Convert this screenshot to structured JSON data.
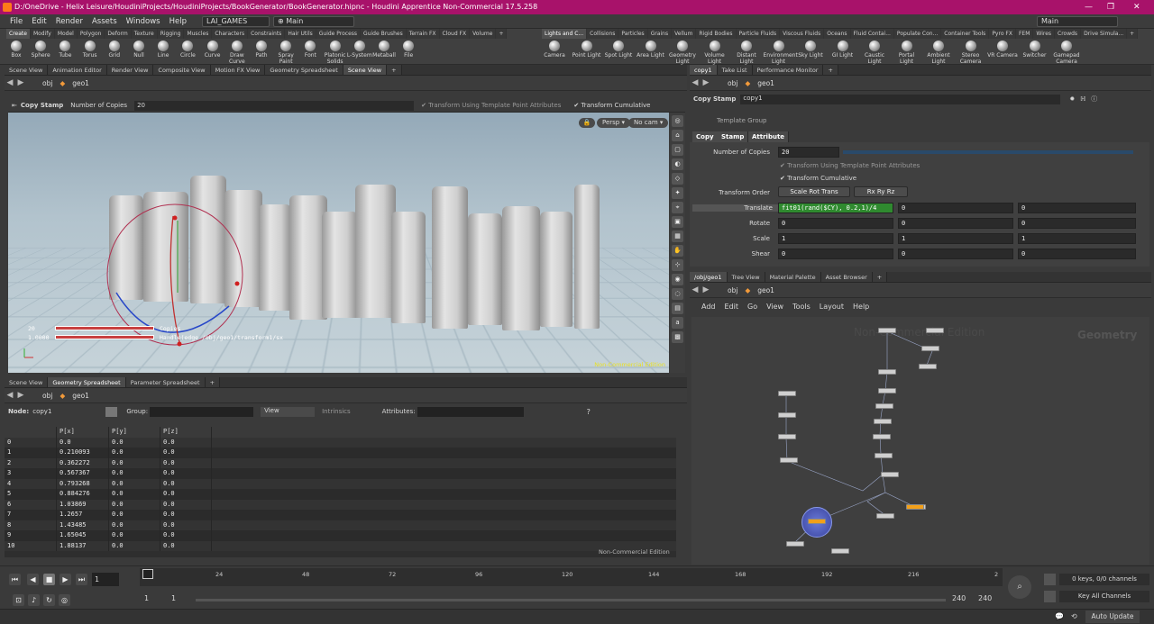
{
  "window": {
    "title": "D:/OneDrive - Helix Leisure/HoudiniProjects/HoudiniProjects/BookGenerator/BookGenerator.hipnc - Houdini Apprentice Non-Commercial 17.5.258",
    "min": "—",
    "max": "❐",
    "close": "✕"
  },
  "menu": {
    "items": [
      "File",
      "Edit",
      "Render",
      "Assets",
      "Windows",
      "Help"
    ],
    "shelf_set": "LAI_GAMES",
    "desktop": "Main",
    "desktop_right": "Main"
  },
  "shelf": {
    "left_tabs": [
      "Create",
      "Modify",
      "Model",
      "Polygon",
      "Deform",
      "Texture",
      "Rigging",
      "Muscles",
      "Characters",
      "Constraints",
      "Hair Utils",
      "Guide Process",
      "Guide Brushes",
      "Terrain FX",
      "Cloud FX",
      "Volume",
      "+"
    ],
    "right_tabs": [
      "Lights and C...",
      "Collisions",
      "Particles",
      "Grains",
      "Vellum",
      "Rigid Bodies",
      "Particle Fluids",
      "Viscous Fluids",
      "Oceans",
      "Fluid Contai...",
      "Populate Con...",
      "Container Tools",
      "Pyro FX",
      "FEM",
      "Wires",
      "Crowds",
      "Drive Simula...",
      "+"
    ],
    "left_tools": [
      "Box",
      "Sphere",
      "Tube",
      "Torus",
      "Grid",
      "Null",
      "Line",
      "Circle",
      "Curve",
      "Draw Curve",
      "Path",
      "Spray Paint",
      "Font",
      "Platonic Solids",
      "L-System",
      "Metaball",
      "File"
    ],
    "right_tools": [
      "Camera",
      "Point Light",
      "Spot Light",
      "Area Light",
      "Geometry Light",
      "Volume Light",
      "Distant Light",
      "Environment Light",
      "Sky Light",
      "GI Light",
      "Caustic Light",
      "Portal Light",
      "Ambient Light",
      "Stereo Camera",
      "VR Camera",
      "Switcher",
      "Gamepad Camera"
    ]
  },
  "left_pane": {
    "tabs": [
      "Scene View",
      "Animation Editor",
      "Render View",
      "Composite View",
      "Motion FX View",
      "Geometry Spreadsheet",
      "Scene View",
      "+"
    ],
    "path": [
      "obj",
      "geo1"
    ],
    "operator": "Copy Stamp",
    "num_copies_label": "Number of Copies",
    "num_copies": "20",
    "opt1": "Transform Using Template Point Attributes",
    "opt2": "Transform Cumulative",
    "persp": "Persp ▾",
    "cam": "No cam ▾",
    "hud_copies_val": "20",
    "hud_copies": "Copies",
    "hud_stamp_val": "1.0000",
    "hud_stamp": "Handle(edge /obj/geo1/transform1/sx",
    "watermark": "Non-Commercial Edition"
  },
  "sheet_pane": {
    "tabs": [
      "Scene View",
      "Geometry Spreadsheet",
      "Parameter Spreadsheet",
      "+"
    ],
    "path": [
      "obj",
      "geo1"
    ],
    "node_label": "Node:",
    "node": "copy1",
    "group_label": "Group:",
    "view": "View",
    "intrinsics": "Intrinsics",
    "attributes_label": "Attributes:",
    "headers": [
      "",
      "P[x]",
      "P[y]",
      "P[z]"
    ],
    "rows": [
      [
        "0",
        "0.0",
        "0.0",
        "0.0"
      ],
      [
        "1",
        "0.210093",
        "0.0",
        "0.0"
      ],
      [
        "2",
        "0.362272",
        "0.0",
        "0.0"
      ],
      [
        "3",
        "0.567367",
        "0.0",
        "0.0"
      ],
      [
        "4",
        "0.793268",
        "0.0",
        "0.0"
      ],
      [
        "5",
        "0.884276",
        "0.0",
        "0.0"
      ],
      [
        "6",
        "1.03869",
        "0.0",
        "0.0"
      ],
      [
        "7",
        "1.2657",
        "0.0",
        "0.0"
      ],
      [
        "8",
        "1.43485",
        "0.0",
        "0.0"
      ],
      [
        "9",
        "1.65045",
        "0.0",
        "0.0"
      ],
      [
        "10",
        "1.88137",
        "0.0",
        "0.0"
      ]
    ],
    "watermark": "Non-Commercial Edition"
  },
  "parm_pane": {
    "tabs": [
      "copy1",
      "Take List",
      "Performance Monitor",
      "+"
    ],
    "path": [
      "obj",
      "geo1"
    ],
    "operator": "Copy Stamp",
    "node_name": "copy1",
    "template_group": "Template Group",
    "subtabs": [
      "Copy",
      "Stamp",
      "Attribute"
    ],
    "num_copies_label": "Number of Copies",
    "num_copies": "20",
    "opt1": "Transform Using Template Point Attributes",
    "opt2": "Transform Cumulative",
    "order_label": "Transform Order",
    "order": "Scale Rot Trans",
    "rot_order": "Rx Ry Rz",
    "translate_label": "Translate",
    "translate": [
      "fit01(rand($CY), 0.2,1)/4",
      "0",
      "0"
    ],
    "rotate_label": "Rotate",
    "rotate": [
      "0",
      "0",
      "0"
    ],
    "scale_label": "Scale",
    "scale": [
      "1",
      "1",
      "1"
    ],
    "shear_label": "Shear",
    "shear": [
      "0",
      "0",
      "0"
    ]
  },
  "net_pane": {
    "tabs": [
      "/obj/geo1",
      "Tree View",
      "Material Palette",
      "Asset Browser",
      "+"
    ],
    "path": [
      "obj",
      "geo1"
    ],
    "menu": [
      "Add",
      "Edit",
      "Go",
      "View",
      "Tools",
      "Layout",
      "Help"
    ],
    "watermark": "Non-Commercial Edition",
    "context": "Geometry"
  },
  "timeline": {
    "frame": "1",
    "ticks": [
      "1",
      "24",
      "48",
      "72",
      "96",
      "120",
      "144",
      "168",
      "192",
      "216",
      "2"
    ],
    "start": "1",
    "start2": "1",
    "end": "240",
    "end2": "240",
    "keys": "0 keys, 0/0 channels",
    "key_all": "Key All Channels"
  },
  "status": {
    "auto_update": "Auto Update"
  }
}
